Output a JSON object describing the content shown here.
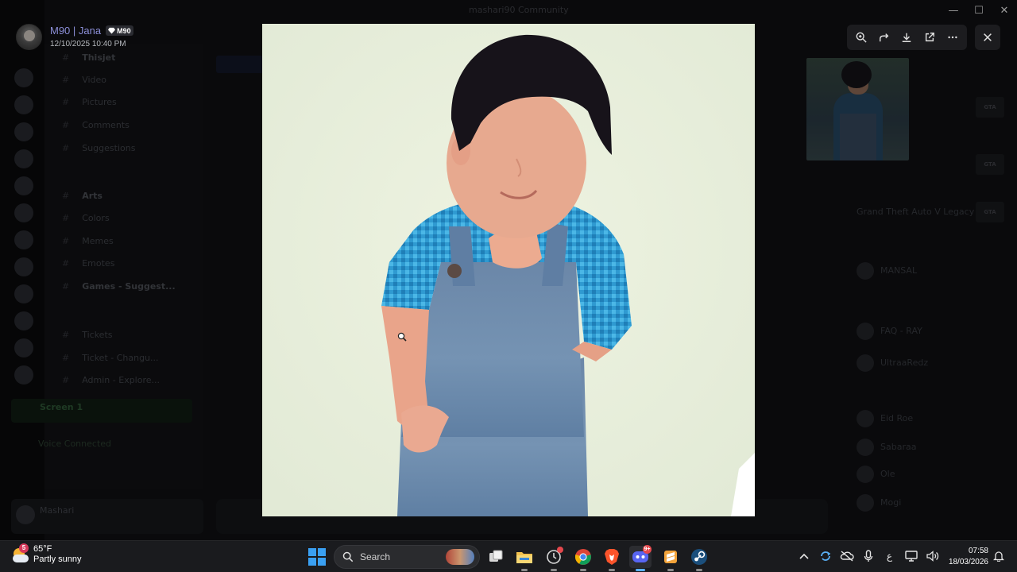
{
  "window": {
    "title": "mashari90 Community",
    "controls": {
      "minimize": "—",
      "maximize": "☐",
      "close": "✕"
    }
  },
  "viewer": {
    "author_name": "M90 | Jana",
    "author_tag": "M90",
    "timestamp": "12/10/2025 10:40 PM",
    "tools": [
      "zoom-in-icon",
      "forward-icon",
      "download-icon",
      "open-external-icon",
      "more-icon"
    ],
    "close_icon": "close-icon"
  },
  "background": {
    "channels": [
      {
        "label": "Thisjet",
        "bold": true
      },
      {
        "label": "Video"
      },
      {
        "label": "Pictures"
      },
      {
        "label": "Comments"
      },
      {
        "label": "Suggestions"
      },
      {
        "label": "Arts",
        "bold": true
      },
      {
        "label": "Colors"
      },
      {
        "label": "Memes"
      },
      {
        "label": "Emotes"
      },
      {
        "label": "Games - Suggest...",
        "bold": true
      },
      {
        "label": "Tickets"
      },
      {
        "label": "Ticket - Changu..."
      },
      {
        "label": "Admin - Explore..."
      }
    ],
    "voice_channel": "Screen 1",
    "rtc_status": "Voice Connected",
    "user_panel_name": "Mashari",
    "members_game": "Grand Theft Auto V Legacy",
    "members": [
      "MANSAL",
      "FAQ - RAY",
      "UltraaRedz",
      "Eid Roe",
      "Sabaraa",
      "Ole",
      "Mogi"
    ]
  },
  "taskbar": {
    "weather": {
      "temp": "65°F",
      "condition": "Partly sunny",
      "badge": "5"
    },
    "search_label": "Search",
    "apps": [
      {
        "name": "task-view-icon"
      },
      {
        "name": "file-explorer-icon"
      },
      {
        "name": "clock-app-icon"
      },
      {
        "name": "chrome-icon"
      },
      {
        "name": "brave-icon"
      },
      {
        "name": "discord-icon",
        "badge": "9+"
      },
      {
        "name": "sublime-icon"
      },
      {
        "name": "steam-icon"
      }
    ],
    "tray_lang": "ع",
    "time": "07:58",
    "date": "18/03/2026"
  },
  "colors": {
    "username": "#8c8fd8",
    "discord_blurple": "#5865f2",
    "taskbar_bg": "#1a1b1e",
    "accent_blue": "#3aa0f2"
  }
}
